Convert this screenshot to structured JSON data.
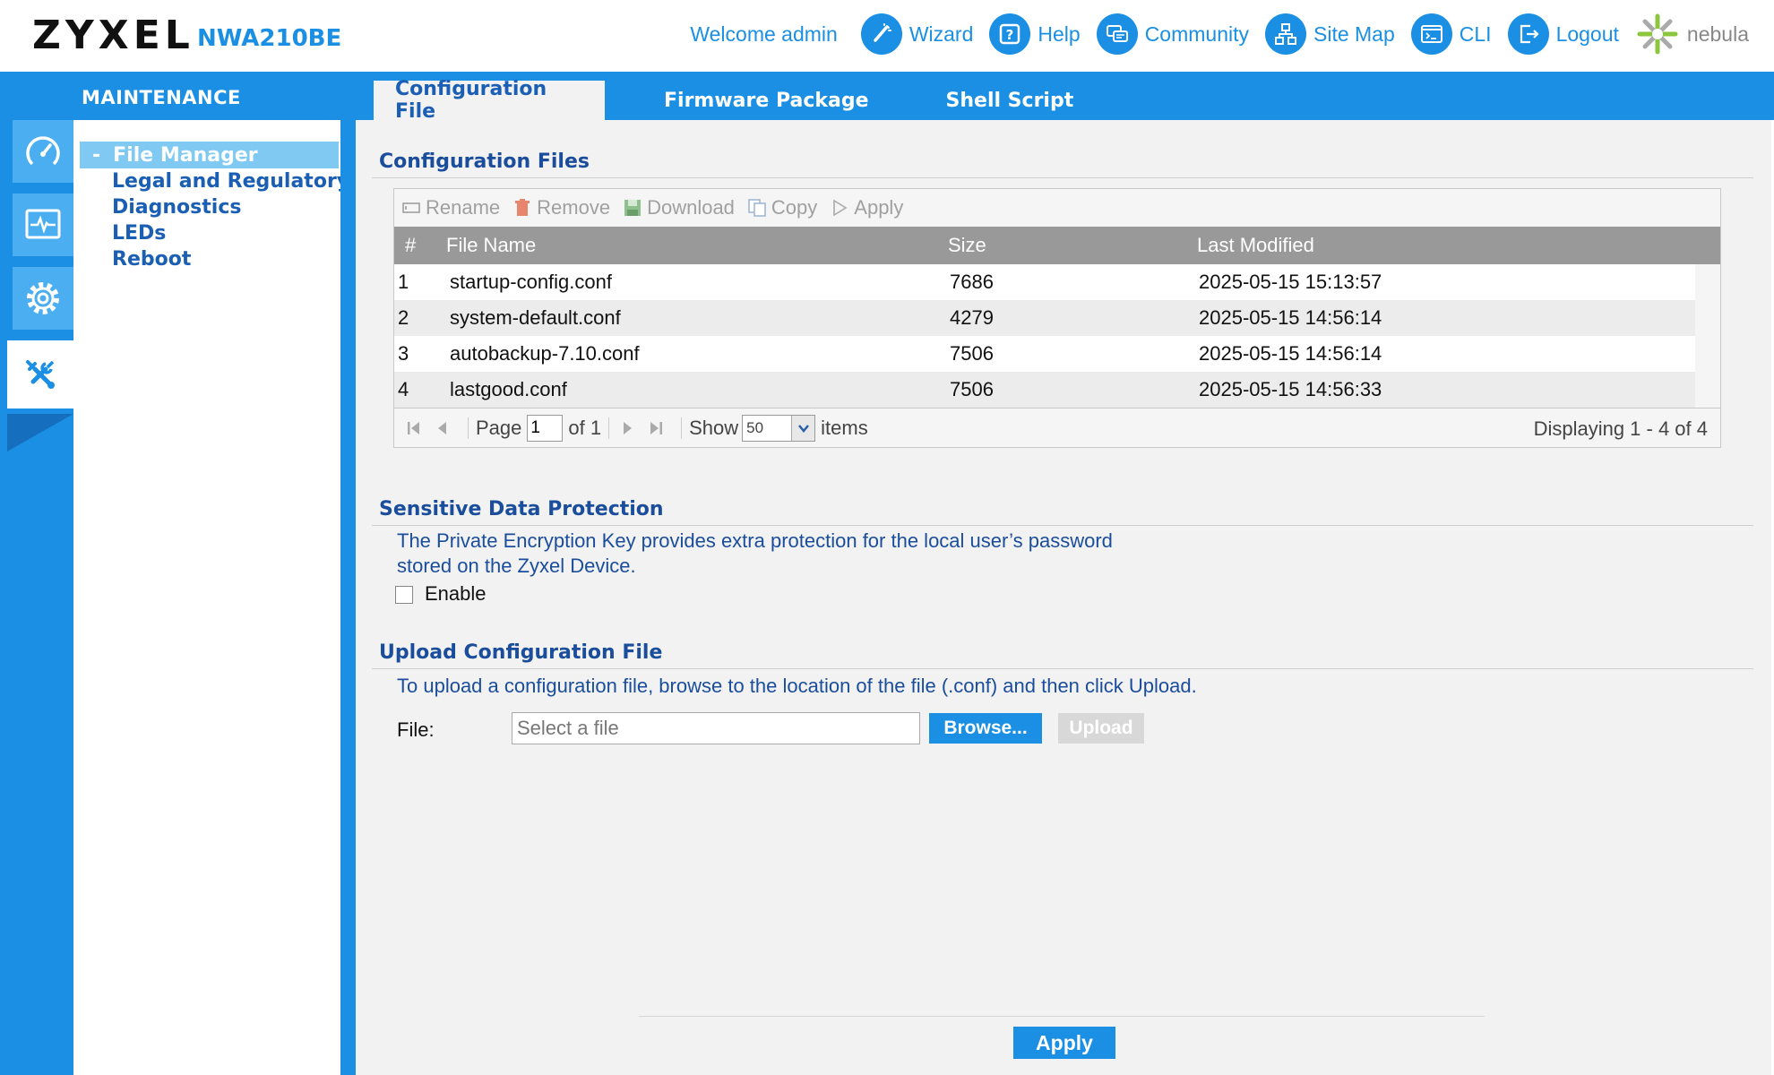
{
  "header": {
    "brand": "ZYXEL",
    "model": "NWA210BE",
    "welcome": "Welcome admin",
    "links": [
      {
        "label": "Wizard",
        "icon": "wizard-icon"
      },
      {
        "label": "Help",
        "icon": "help-icon"
      },
      {
        "label": "Community",
        "icon": "community-icon"
      },
      {
        "label": "Site Map",
        "icon": "sitemap-icon"
      },
      {
        "label": "CLI",
        "icon": "cli-icon"
      },
      {
        "label": "Logout",
        "icon": "logout-icon"
      }
    ],
    "nebula": "nebula"
  },
  "section_title": "MAINTENANCE",
  "tabs": [
    {
      "label": "Configuration File",
      "active": true
    },
    {
      "label": "Firmware Package",
      "active": false
    },
    {
      "label": "Shell Script",
      "active": false
    }
  ],
  "rail": [
    {
      "icon": "dashboard-icon"
    },
    {
      "icon": "monitor-icon"
    },
    {
      "icon": "configuration-gear-icon"
    },
    {
      "icon": "maintenance-tools-icon",
      "active": true
    }
  ],
  "menu": {
    "items": [
      {
        "label": "File Manager",
        "active": true
      },
      {
        "label": "Legal and Regulatory"
      },
      {
        "label": "Diagnostics"
      },
      {
        "label": "LEDs"
      },
      {
        "label": "Reboot"
      }
    ]
  },
  "config_files": {
    "title": "Configuration Files",
    "toolbar": {
      "rename": "Rename",
      "remove": "Remove",
      "download": "Download",
      "copy": "Copy",
      "apply": "Apply"
    },
    "columns": [
      "#",
      "File Name",
      "Size",
      "Last Modified"
    ],
    "rows": [
      {
        "num": "1",
        "name": "startup-config.conf",
        "size": "7686",
        "modified": "2025-05-15 15:13:57"
      },
      {
        "num": "2",
        "name": "system-default.conf",
        "size": "4279",
        "modified": "2025-05-15 14:56:14"
      },
      {
        "num": "3",
        "name": "autobackup-7.10.conf",
        "size": "7506",
        "modified": "2025-05-15 14:56:14"
      },
      {
        "num": "4",
        "name": "lastgood.conf",
        "size": "7506",
        "modified": "2025-05-15 14:56:33"
      }
    ],
    "pager": {
      "page_label": "Page",
      "page_value": "1",
      "of_label": "of 1",
      "show_label": "Show",
      "show_value": "50",
      "items_label": "items",
      "displaying": "Displaying 1 - 4 of 4"
    }
  },
  "sensitive": {
    "title": "Sensitive Data Protection",
    "desc_line1": "The Private Encryption Key provides extra protection for the local user’s password",
    "desc_line2": "stored on the Zyxel Device.",
    "enable_label": "Enable"
  },
  "upload": {
    "title": "Upload Configuration File",
    "desc": "To upload a configuration file, browse to the location of the file (.conf) and then click Upload.",
    "file_label": "File:",
    "placeholder": "Select a file",
    "browse": "Browse...",
    "upload": "Upload"
  },
  "footer": {
    "apply": "Apply"
  },
  "colors": {
    "accent": "#1a8fe3",
    "title_blue": "#1a4d9c",
    "header_gray": "#999999"
  }
}
